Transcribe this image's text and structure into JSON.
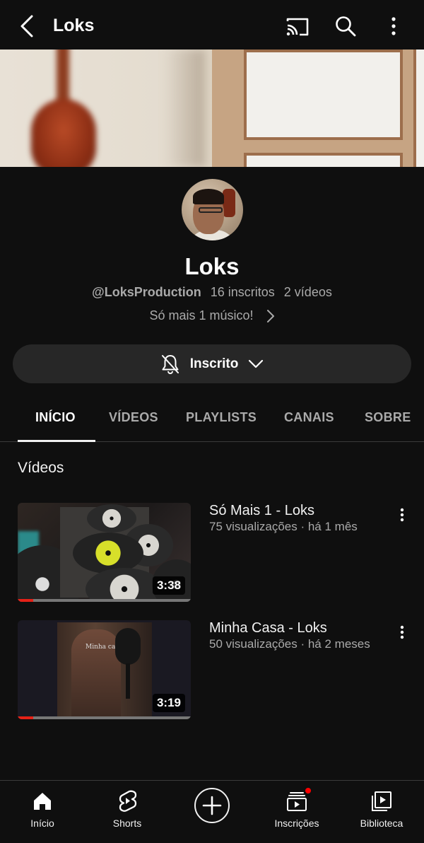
{
  "header": {
    "title": "Loks",
    "back_icon": "back-arrow-icon",
    "cast_icon": "cast-icon",
    "search_icon": "search-icon",
    "more_icon": "more-vertical-icon"
  },
  "channel": {
    "name": "Loks",
    "handle": "@LoksProduction",
    "subscribers": "16 inscritos",
    "video_count": "2 vídeos",
    "description": "Só mais 1 músico!",
    "subscribe_label": "Inscrito"
  },
  "tabs": [
    {
      "label": "INÍCIO",
      "active": true
    },
    {
      "label": "VÍDEOS",
      "active": false
    },
    {
      "label": "PLAYLISTS",
      "active": false
    },
    {
      "label": "CANAIS",
      "active": false
    },
    {
      "label": "SOBRE",
      "active": false
    }
  ],
  "section": {
    "title": "Vídeos"
  },
  "videos": [
    {
      "title": "Só Mais 1 - Loks",
      "meta": "75 visualizações · há 1 mês",
      "duration": "3:38",
      "watched_fraction": 0.09
    },
    {
      "title": "Minha Casa - Loks",
      "meta": "50 visualizações · há 2 meses",
      "duration": "3:19",
      "watched_fraction": 0.09
    }
  ],
  "thumb_text": {
    "minha_casa": "Minha casa"
  },
  "bottom_nav": [
    {
      "label": "Início",
      "icon": "home-icon"
    },
    {
      "label": "Shorts",
      "icon": "shorts-icon"
    },
    {
      "label": "",
      "icon": "create-plus-icon"
    },
    {
      "label": "Inscrições",
      "icon": "subscriptions-icon"
    },
    {
      "label": "Biblioteca",
      "icon": "library-icon"
    }
  ],
  "colors": {
    "background": "#0f0f0f",
    "accent": "#ff0000",
    "progress": "#e62117",
    "secondary_text": "#aaaaaa"
  }
}
